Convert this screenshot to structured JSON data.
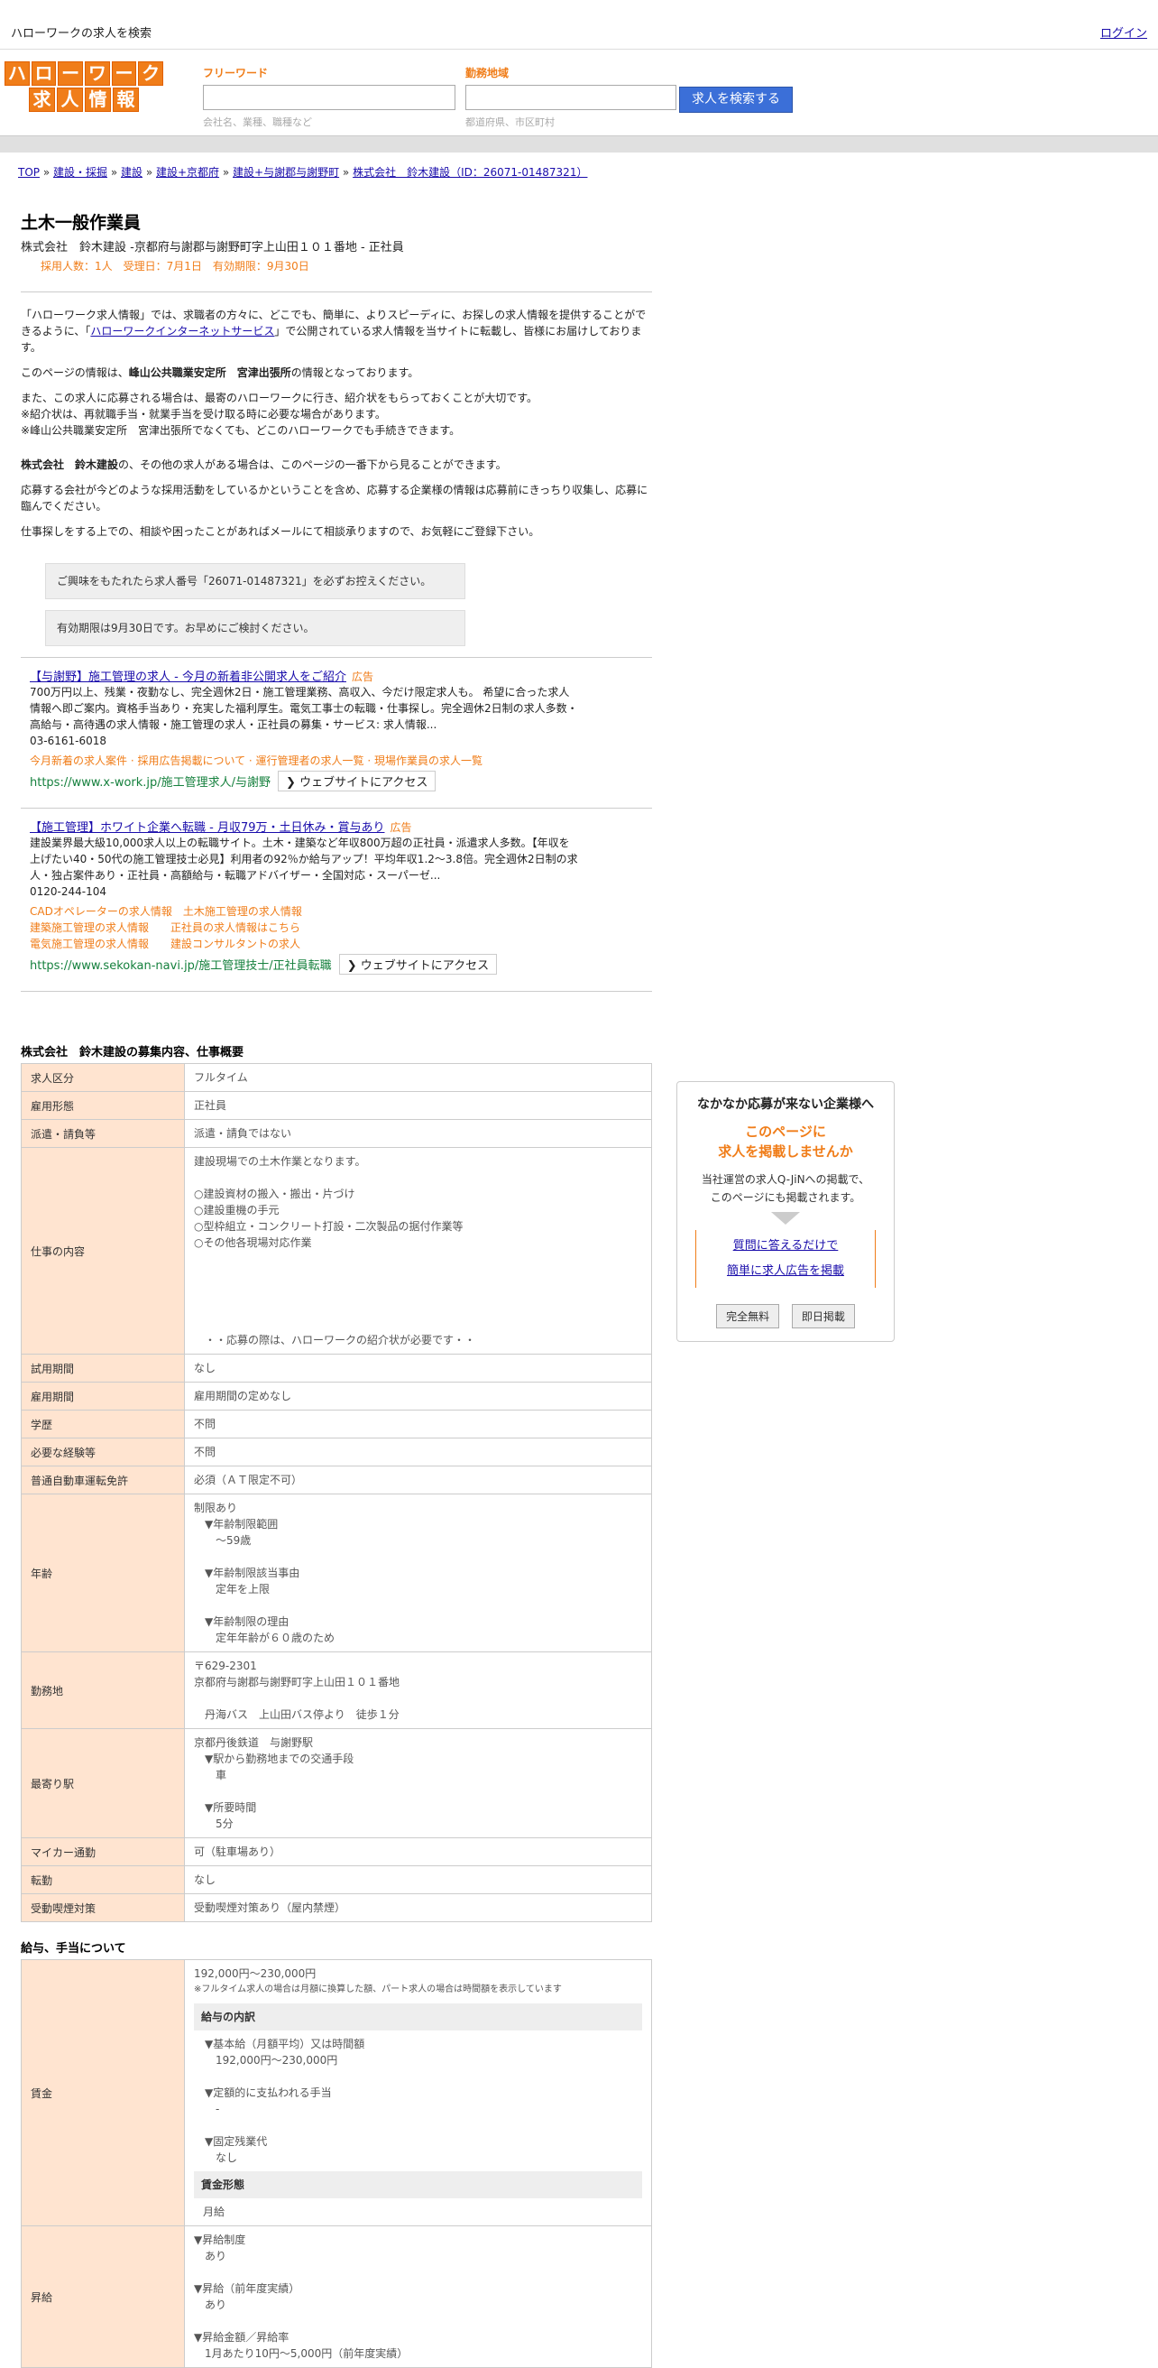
{
  "topbar": {
    "title": "ハローワークの求人を検索",
    "login": "ログイン"
  },
  "logo": {
    "row1": [
      "ハ",
      "ロ",
      "ー",
      "ワ",
      "ー",
      "ク"
    ],
    "row2": [
      "求",
      "人",
      "情",
      "報"
    ]
  },
  "search": {
    "freeword_label": "フリーワード",
    "freeword_placeholder": "会社名、業種、職種など",
    "area_label": "勤務地域",
    "area_placeholder": "都道府県、市区町村",
    "button": "求人を検索する"
  },
  "breadcrumb": [
    "TOP",
    "建設・採掘",
    "建設",
    "建設+京都府",
    "建設+与謝郡与謝野町",
    "株式会社　鈴木建設（ID：26071-01487321）"
  ],
  "job": {
    "title": "土木一般作業員",
    "subtitle": "株式会社　鈴木建設 -京都府与謝郡与謝野町字上山田１０１番地 - 正社員",
    "meta": "採用人数：1人　受理日：7月1日　有効期限：9月30日"
  },
  "intro": {
    "p1a": "「ハローワーク求人情報」では、求職者の方々に、どこでも、簡単に、よりスピーディに、お探しの求人情報を提供することができるように、「",
    "p1link": "ハローワークインターネットサービス",
    "p1b": "」で公開されている求人情報を当サイトに転載し、皆様にお届けしております。",
    "p2a": "このページの情報は、",
    "p2b": "峰山公共職業安定所　宮津出張所",
    "p2c": "の情報となっております。",
    "p3": "また、この求人に応募される場合は、最寄のハローワークに行き、紹介状をもらっておくことが大切です。",
    "p4": "※紹介状は、再就職手当・就業手当を受け取る時に必要な場合があります。",
    "p5": "※峰山公共職業安定所　宮津出張所でなくても、どこのハローワークでも手続きできます。",
    "p6a": "株式会社　鈴木建設",
    "p6b": "の、その他の求人がある場合は、このページの一番下から見ることができます。",
    "p7": "応募する会社が今どのような採用活動をしているかということを含め、応募する企業様の情報は応募前にきっちり収集し、応募に臨んでください。",
    "p8": "仕事探しをする上での、相談や困ったことがあればメールにて相談承りますので、お気軽にご登録下さい。"
  },
  "notes": {
    "n1": "ご興味をもたれたら求人番号「26071-01487321」を必ずお控えください。",
    "n2": "有効期限は9月30日です。お早めにご検討ください。"
  },
  "ads": [
    {
      "title": "【与謝野】施工管理の求人 - 今月の新着非公開求人をご紹介",
      "tag": "広告",
      "desc": "700万円以上、残業・夜勤なし、完全週休2日・施工管理業務、高収入、今だけ限定求人も。 希望に合った求人情報へ即ご案内。資格手当あり・充実した福利厚生。電気工事士の転職・仕事探し。完全週休2日制の求人多数・高給与・高待遇の求人情報・施工管理の求人・正社員の募集・サービス: 求人情報...",
      "tel": "03-6161-6018",
      "links": "今月新着の求人案件 · 採用広告掲載について · 運行管理者の求人一覧 · 現場作業員の求人一覧",
      "url": "https://www.x-work.jp/施工管理求人/与謝野",
      "visit": "❯ ウェブサイトにアクセス"
    },
    {
      "title": "【施工管理】ホワイト企業へ転職 - 月収79万・土日休み・賞与あり",
      "tag": "広告",
      "desc": "建設業界最大級10,000求人以上の転職サイト。土木・建築など年収800万超の正社員・派遣求人多数。【年収を上げたい40・50代の施工管理技士必見】利用者の92％か給与アップ！平均年収1.2～3.8倍。完全週休2日制の求人・独占案件あり・正社員・高額給与・転職アドバイザー・全国対応・スーパーゼ...",
      "tel": "0120-244-104",
      "links": "CADオペレーターの求人情報　土木施工管理の求人情報\n建築施工管理の求人情報　　正社員の求人情報はこちら\n電気施工管理の求人情報　　建設コンサルタントの求人",
      "url": "https://www.sekokan-navi.jp/施工管理技士/正社員転職",
      "visit": "❯ ウェブサイトにアクセス"
    }
  ],
  "recruit": {
    "heading": "株式会社　鈴木建設の募集内容、仕事概要",
    "rows": [
      {
        "k": "求人区分",
        "v": "フルタイム"
      },
      {
        "k": "雇用形態",
        "v": "正社員"
      },
      {
        "k": "派遣・請負等",
        "v": "派遣・請負ではない"
      },
      {
        "k": "仕事の内容",
        "v": "建設現場での土木作業となります。\n\n○建設資材の搬入・搬出・片づけ\n○建設重機の手元\n○型枠組立・コンクリート打設・二次製品の据付作業等\n○その他各現場対応作業\n\n\n\n\n\n　・・応募の際は、ハローワークの紹介状が必要です・・"
      },
      {
        "k": "試用期間",
        "v": "なし"
      },
      {
        "k": "雇用期間",
        "v": "雇用期間の定めなし"
      },
      {
        "k": "学歴",
        "v": "不問"
      },
      {
        "k": "必要な経験等",
        "v": "不問"
      },
      {
        "k": "普通自動車運転免許",
        "v": "必須（ＡＴ限定不可）"
      },
      {
        "k": "年齢",
        "v": "制限あり\n　▼年齢制限範囲\n　　～59歳\n\n　▼年齢制限該当事由\n　　定年を上限\n\n　▼年齢制限の理由\n　　定年年齢が６０歳のため"
      },
      {
        "k": "勤務地",
        "v": "〒629-2301\n京都府与謝郡与謝野町字上山田１０１番地\n\n　丹海バス　上山田バス停より　徒歩１分"
      },
      {
        "k": "最寄り駅",
        "v": "京都丹後鉄道　与謝野駅\n　▼駅から勤務地までの交通手段\n　　車\n\n　▼所要時間\n　　5分"
      },
      {
        "k": "マイカー通勤",
        "v": "可（駐車場あり）"
      },
      {
        "k": "転勤",
        "v": "なし"
      },
      {
        "k": "受動喫煙対策",
        "v": "受動喫煙対策あり（屋内禁煙）"
      }
    ]
  },
  "salary": {
    "heading": "給与、手当について",
    "wage_label": "賃金",
    "wage_range": "192,000円〜230,000円",
    "wage_note": "※フルタイム求人の場合は月額に換算した額、パート求人の場合は時間額を表示しています",
    "breakdown_h": "給与の内訳",
    "breakdown": "　▼基本給（月額平均）又は時間額\n　　192,000円〜230,000円\n\n　▼定額的に支払われる手当\n　　-\n\n　▼固定残業代\n　　なし",
    "form_h": "賃金形態",
    "form": "月給",
    "raise_label": "昇給",
    "raise": "▼昇給制度\n　あり\n\n▼昇給（前年度実績）\n　あり\n\n▼昇給金額／昇給率\n　1月あたり10円〜5,000円（前年度実績）"
  },
  "side": {
    "h": "なかなか応募が来ない企業様へ",
    "o1": "このページに",
    "o2": "求人を掲載しませんか",
    "d": "当社運営の求人Q-JiNへの掲載で、\nこのページにも掲載されます。",
    "l1": "質問に答えるだけで",
    "l2": "簡単に求人広告を掲載",
    "b1": "完全無料",
    "b2": "即日掲載"
  }
}
